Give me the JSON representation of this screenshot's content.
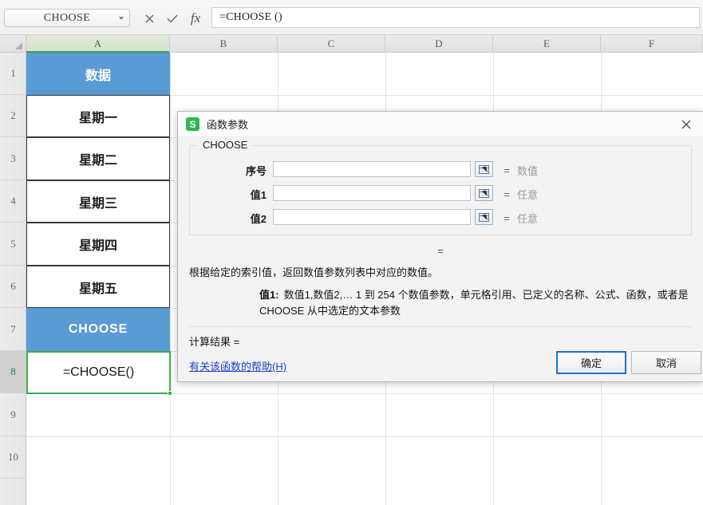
{
  "formula_bar": {
    "name_box_value": "CHOOSE",
    "cancel_icon": "close-icon",
    "accept_icon": "check-icon",
    "fx_icon": "fx-icon",
    "fx_label": "fx",
    "cancel_glyph": "✕",
    "accept_glyph": "✓",
    "formula_value": "=CHOOSE ()"
  },
  "grid": {
    "column_headers": [
      "A",
      "B",
      "C",
      "D",
      "E",
      "F"
    ],
    "row_headers": [
      "1",
      "2",
      "3",
      "4",
      "5",
      "6",
      "7",
      "8",
      "9",
      "10"
    ],
    "selected_column": "A",
    "selected_row": "8",
    "column_a_cells": [
      {
        "row": "1",
        "value": "数据",
        "style": "header"
      },
      {
        "row": "2",
        "value": "星期一",
        "style": "data"
      },
      {
        "row": "3",
        "value": "星期二",
        "style": "data"
      },
      {
        "row": "4",
        "value": "星期三",
        "style": "data"
      },
      {
        "row": "5",
        "value": "星期四",
        "style": "data"
      },
      {
        "row": "6",
        "value": "星期五",
        "style": "data"
      },
      {
        "row": "7",
        "value": "CHOOSE",
        "style": "header"
      },
      {
        "row": "8",
        "value": "=CHOOSE()",
        "style": "active"
      }
    ]
  },
  "dialog": {
    "icon": "wps-spreadsheet-icon",
    "icon_letter": "S",
    "title": "函数参数",
    "close_icon": "close-icon",
    "close_glyph": "✕",
    "group_legend": "CHOOSE",
    "args": [
      {
        "label": "序号",
        "value": "",
        "eq": "=",
        "type": "数值",
        "picker_icon": "range-picker-icon"
      },
      {
        "label": "值1",
        "value": "",
        "eq": "=",
        "type": "任意",
        "picker_icon": "range-picker-icon"
      },
      {
        "label": "值2",
        "value": "",
        "eq": "=",
        "type": "任意",
        "picker_icon": "range-picker-icon"
      }
    ],
    "result_eq": "=",
    "description": "根据给定的索引值，返回数值参数列表中对应的数值。",
    "arg_help_name": "值1:",
    "arg_help_text": "数值1,数值2,… 1 到 254 个数值参数，单元格引用、已定义的名称、公式、函数，或者是 CHOOSE 从中选定的文本参数",
    "calc_result_label": "计算结果  =",
    "help_link": "有关该函数的帮助(H)",
    "ok_label": "确定",
    "cancel_label": "取消"
  },
  "colors": {
    "header_blue": "#5b9bd5",
    "active_cell_green": "#3fae4b",
    "primary_button_border": "#1a73c8",
    "link_blue": "#1a3ecb",
    "wps_green": "#2fb457"
  }
}
